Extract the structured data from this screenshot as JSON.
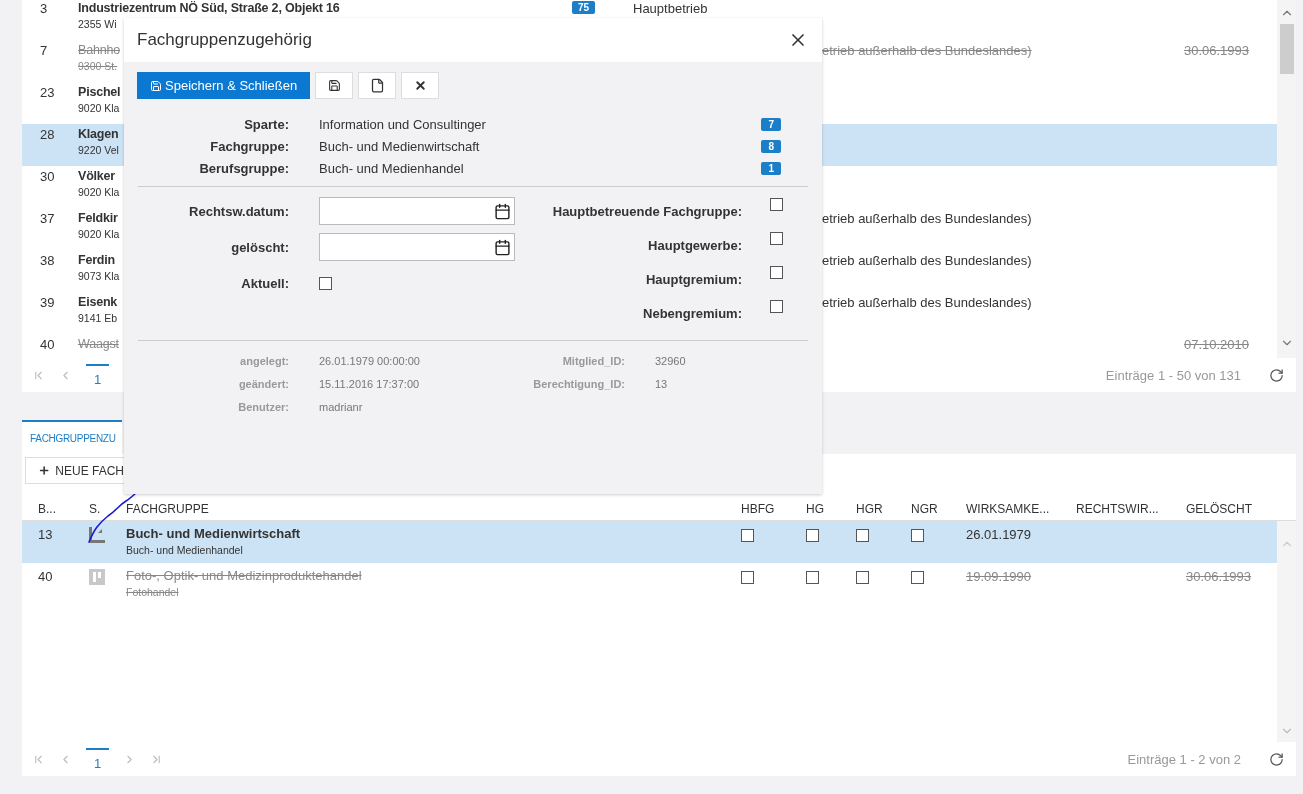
{
  "top_table": {
    "rows": [
      {
        "number": "3",
        "name": "Industriezentrum NÖ Süd, Straße 2, Objekt 16",
        "address": "2355 Wi",
        "badge": "75",
        "type": "Hauptbetrieb",
        "struck": false,
        "selected": false
      },
      {
        "number": "7",
        "name": "Bahnho",
        "address": "9300 St.",
        "type_tail": "etrieb außerhalb des Bundeslandes)",
        "deleted": "30.06.1993",
        "struck": true,
        "selected": false
      },
      {
        "number": "23",
        "name": "Pischel",
        "address": "9020 Kla",
        "struck": false,
        "selected": false
      },
      {
        "number": "28",
        "name": "Klagen",
        "address": "9220 Vel",
        "struck": false,
        "selected": true
      },
      {
        "number": "30",
        "name": "Völker",
        "address": "9020 Kla",
        "struck": false,
        "selected": false
      },
      {
        "number": "37",
        "name": "Feldkir",
        "address": "9020 Kla",
        "type_tail": "etrieb außerhalb des Bundeslandes)",
        "struck": false,
        "selected": false
      },
      {
        "number": "38",
        "name": "Ferdin",
        "address": "9073 Kla",
        "type_tail": "etrieb außerhalb des Bundeslandes)",
        "struck": false,
        "selected": false
      },
      {
        "number": "39",
        "name": "Eisenk",
        "address": "9141 Eb",
        "type_tail": "etrieb außerhalb des Bundeslandes)",
        "struck": false,
        "selected": false
      },
      {
        "number": "40",
        "name": "Waagst",
        "deleted": "07.10.2010",
        "struck": true,
        "selected": false
      }
    ],
    "pager": {
      "page": "1",
      "summary": "Einträge 1 - 50 von 131"
    }
  },
  "bottom_panel": {
    "tab": {
      "label": "FACHGRUPPENZU",
      "selected": true
    },
    "new_button": "NEUE FACH",
    "columns": [
      "B...",
      "S.",
      "FACHGRUPPE",
      "HBFG",
      "HG",
      "HGR",
      "NGR",
      "WIRKSAMKE...",
      "RECHTSWIR...",
      "GELÖSCHT"
    ],
    "rows": [
      {
        "number": "13",
        "name": "Buch- und Medienwirtschaft",
        "subtitle": "Buch- und Medienhandel",
        "checks": [
          {
            "checked": false
          },
          {
            "checked": false
          },
          {
            "checked": false
          },
          {
            "checked": false
          }
        ],
        "effective": "26.01.1979",
        "struck": false,
        "selected": true
      },
      {
        "number": "40",
        "name": "Foto-, Optik- und Medizinproduktehandel",
        "subtitle": "Fotohandel",
        "checks": [
          {
            "checked": false
          },
          {
            "checked": false
          },
          {
            "checked": false
          },
          {
            "checked": false
          }
        ],
        "effective": "19.09.1990",
        "deleted": "30.06.1993",
        "struck": true,
        "selected": false
      }
    ],
    "pager": {
      "page": "1",
      "summary": "Einträge 1 - 2 von 2"
    }
  },
  "dialog": {
    "title": "Fachgruppenzugehörig",
    "save_close": "Speichern & Schließen",
    "info": [
      {
        "label": "Sparte:",
        "value": "Information und Consultinger",
        "badge": "7"
      },
      {
        "label": "Fachgruppe:",
        "value": "Buch- und Medienwirtschaft",
        "badge": "8"
      },
      {
        "label": "Berufsgruppe:",
        "value": "Buch- und Medienhandel",
        "badge": "1"
      }
    ],
    "form_left": [
      {
        "label": "Rechtsw.datum:",
        "kind": "date"
      },
      {
        "label": "gelöscht:",
        "kind": "date"
      },
      {
        "label": "Aktuell:",
        "kind": "checkbox",
        "checked": false
      }
    ],
    "form_right": [
      {
        "label": "Hauptbetreuende Fachgruppe:",
        "checked": false
      },
      {
        "label": "Hauptgewerbe:",
        "checked": false
      },
      {
        "label": "Hauptgremium:",
        "checked": false
      },
      {
        "label": "Nebengremium:",
        "checked": false
      }
    ],
    "meta_left": [
      {
        "label": "angelegt:",
        "value": "26.01.1979 00:00:00"
      },
      {
        "label": "geändert:",
        "value": "15.11.2016 17:37:00"
      },
      {
        "label": "Benutzer:",
        "value": "madrianr"
      }
    ],
    "meta_right": [
      {
        "label": "Mitglied_ID:",
        "value": "32960"
      },
      {
        "label": "Berechtigung_ID:",
        "value": "13"
      }
    ]
  }
}
